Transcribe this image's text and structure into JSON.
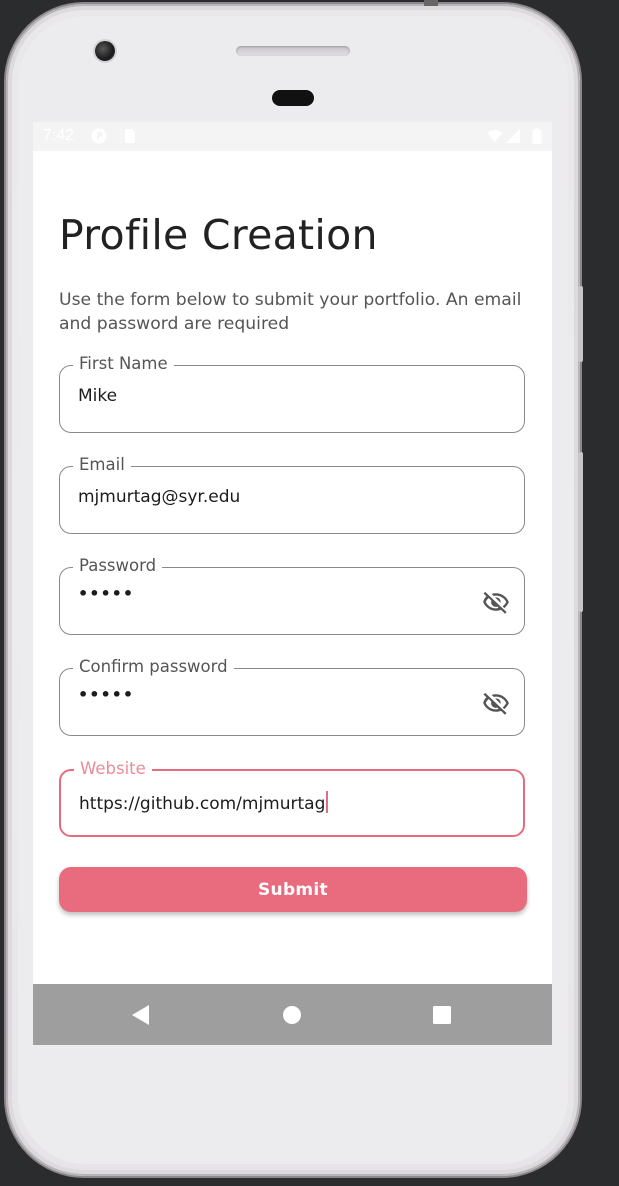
{
  "status_bar": {
    "time": "7:42",
    "icons": [
      "notification-icon",
      "sd-card-icon",
      "wifi-icon",
      "signal-icon",
      "battery-icon"
    ]
  },
  "form": {
    "title": "Profile Creation",
    "subtitle": "Use the form below to submit your portfolio. An email and password are required",
    "fields": [
      {
        "label": "First Name",
        "value": "Mike",
        "type": "text"
      },
      {
        "label": "Email",
        "value": "mjmurtag@syr.edu",
        "type": "email"
      },
      {
        "label": "Password",
        "value": "•••••",
        "type": "password",
        "toggle_icon": "visibility-off-icon"
      },
      {
        "label": "Confirm password",
        "value": "•••••",
        "type": "password",
        "toggle_icon": "visibility-off-icon"
      },
      {
        "label": "Website",
        "value": "https://github.com/mjmurtag",
        "type": "url",
        "focused": true
      }
    ],
    "submit_label": "Submit"
  },
  "colors": {
    "accent": "#e96c7e",
    "label": "#555555",
    "border": "#8a8a8a",
    "nav_bar": "#9e9e9e"
  },
  "nav_bar": {
    "buttons": [
      "back-icon",
      "home-icon",
      "recents-icon"
    ]
  }
}
